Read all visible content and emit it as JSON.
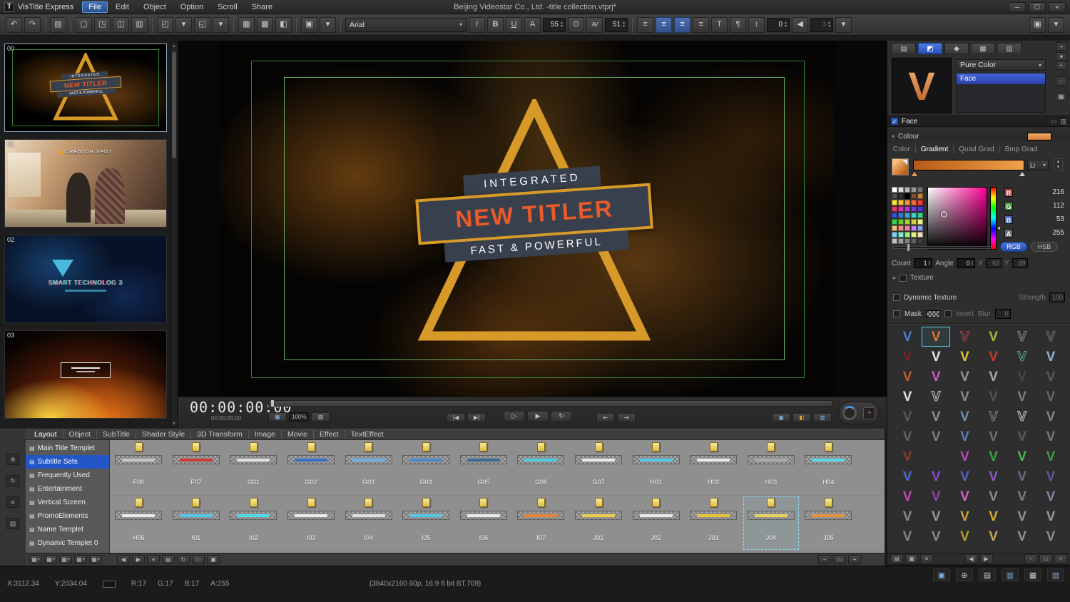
{
  "window": {
    "app_name": "VisTitle Express",
    "title": "Beijing Videostar Co., Ltd. -title collection.vtprj*",
    "menus": [
      "File",
      "Edit",
      "Object",
      "Option",
      "Scroll",
      "Share"
    ],
    "active_menu": "File"
  },
  "icons": {
    "logo": "T",
    "minimize": "─",
    "maximize": "▢",
    "close": "×",
    "undo": "↶",
    "redo": "↷",
    "template-browser": "▤",
    "new-doc": "▢",
    "open-doc": "◳",
    "save-doc": "◫",
    "page-setup": "▥",
    "import": "◰",
    "export": "◱",
    "align-objects": "▦",
    "distribute": "▩",
    "group": "◧",
    "image-tool": "▣",
    "italic": "I",
    "bold": "B",
    "underline": "U",
    "font-size": "A",
    "lock": "⊙",
    "kerning": "AV",
    "align-left": "≡",
    "align-center": "≡",
    "align-right": "≡",
    "align-justify": "≡",
    "vertical-text": "T",
    "text-direction": "¶",
    "line-spacing": "↕",
    "audio": "◀",
    "dropdown": "▾",
    "monitor": "▣",
    "left-arrow": "◀",
    "right-arrow": "▶",
    "list-view": "≡",
    "grid-view": "▤",
    "small-grid": "▦",
    "loop": "↻",
    "rect": "▭",
    "minus": "−",
    "plus": "+",
    "plus-circle": "⊕",
    "levels": "▥",
    "frame-back": "|◀",
    "frame-fwd": "▶|",
    "play-outline": "▷",
    "play": "▶",
    "jump-start": "⇤",
    "jump-end": "⇥",
    "zoom-a": "▦",
    "zoom-b": "▧",
    "screen-1": "▣",
    "screen-2": "◧",
    "screen-3": "▥",
    "crosshair": "+",
    "text-tab": "▤",
    "color-tab": "◩",
    "effect-tab": "◆",
    "texture-tab": "▦",
    "library-tab": "▥",
    "check": "✓",
    "collapse": "▾",
    "expand": "▸",
    "up": "▴",
    "down": "▾",
    "hue-marker": "◂",
    "doc": "▤"
  },
  "toolbar": {
    "font_family": "Arial",
    "font_size": "55",
    "kerning": "51",
    "letter_spacing": "0",
    "audio_level": "3",
    "items": [
      {
        "t": "b",
        "i": "undo",
        "n": "undo"
      },
      {
        "t": "b",
        "i": "redo",
        "n": "redo"
      },
      {
        "t": "s"
      },
      {
        "t": "b",
        "i": "template-browser",
        "n": "template-browser"
      },
      {
        "t": "s"
      },
      {
        "t": "b",
        "i": "new-doc",
        "n": "new-document"
      },
      {
        "t": "b",
        "i": "open-doc",
        "n": "open-document"
      },
      {
        "t": "b",
        "i": "save-doc",
        "n": "save-document"
      },
      {
        "t": "b",
        "i": "page-setup",
        "n": "page-setup"
      },
      {
        "t": "s"
      },
      {
        "t": "b",
        "i": "import",
        "n": "import-template"
      },
      {
        "t": "b",
        "i": "dropdown",
        "n": "import-options"
      },
      {
        "t": "b",
        "i": "export",
        "n": "export-template"
      },
      {
        "t": "b",
        "i": "dropdown",
        "n": "export-options"
      },
      {
        "t": "s"
      },
      {
        "t": "b",
        "i": "align-objects",
        "n": "align-objects"
      },
      {
        "t": "b",
        "i": "distribute",
        "n": "distribute-objects"
      },
      {
        "t": "b",
        "i": "group",
        "n": "group-objects"
      },
      {
        "t": "s"
      },
      {
        "t": "b",
        "i": "image-tool",
        "n": "insert-image"
      },
      {
        "t": "b",
        "i": "dropdown",
        "n": "insert-options"
      },
      {
        "t": "s"
      },
      {
        "t": "font",
        "n": "font-family-select",
        "bind": "font_family"
      },
      {
        "t": "b",
        "i": "italic",
        "n": "italic"
      },
      {
        "t": "b",
        "i": "bold",
        "n": "bold"
      },
      {
        "t": "b",
        "i": "underline",
        "n": "underline"
      },
      {
        "t": "b",
        "i": "font-size",
        "n": "font-size"
      },
      {
        "t": "spin",
        "n": "font-size-value",
        "bind": "font_size"
      },
      {
        "t": "b",
        "i": "lock",
        "n": "lock-aspect"
      },
      {
        "t": "b",
        "i": "kerning",
        "n": "kerning"
      },
      {
        "t": "spin",
        "n": "kerning-value",
        "bind": "kerning"
      },
      {
        "t": "s"
      },
      {
        "t": "b",
        "i": "align-left",
        "n": "align-left"
      },
      {
        "t": "b",
        "i": "align-center",
        "n": "align-center",
        "sel": true
      },
      {
        "t": "b",
        "i": "align-right",
        "n": "align-right",
        "sel": true
      },
      {
        "t": "b",
        "i": "align-justify",
        "n": "align-justify"
      },
      {
        "t": "b",
        "i": "vertical-text",
        "n": "vertical-text"
      },
      {
        "t": "b",
        "i": "text-direction",
        "n": "text-direction"
      },
      {
        "t": "b",
        "i": "line-spacing",
        "n": "line-spacing"
      },
      {
        "t": "spin",
        "n": "letter-spacing-value",
        "bind": "letter_spacing"
      },
      {
        "t": "b",
        "i": "audio",
        "n": "audio-sync"
      },
      {
        "t": "spin",
        "n": "audio-level-value",
        "bind": "audio_level",
        "dis": true
      },
      {
        "t": "b",
        "i": "dropdown",
        "n": "more-text-options"
      },
      {
        "t": "gap"
      },
      {
        "t": "b",
        "i": "monitor",
        "n": "external-monitor"
      },
      {
        "t": "b",
        "i": "dropdown",
        "n": "monitor-options"
      }
    ]
  },
  "thumbnails": {
    "items": [
      {
        "index": "00"
      },
      {
        "index": "01",
        "caption": "CREATOR SPOT"
      },
      {
        "index": "02",
        "caption": "SMART TECHNOLOG 3"
      },
      {
        "index": "03"
      }
    ]
  },
  "preview": {
    "banner": {
      "line1": "INTEGRATED",
      "line2": "NEW TITLER",
      "line3": "FAST & POWERFUL"
    },
    "timecode": "00:00:00:00",
    "timecode_sub": "00:00:05:00",
    "zoom": "100%"
  },
  "panel_tabs": [
    "Layout",
    "Object",
    "SubTitle",
    "Shader Style",
    "3D Transform",
    "Image",
    "Movie",
    "Effect",
    "TextEffect"
  ],
  "categories": {
    "items": [
      {
        "label": "Main Title Templet"
      },
      {
        "label": "Subtitle Sets",
        "selected": true
      },
      {
        "label": "Frequently Used"
      },
      {
        "label": "Entertainment"
      },
      {
        "label": "Vertical Screen"
      },
      {
        "label": "PromoElements"
      },
      {
        "label": "Name Templet"
      },
      {
        "label": "Dynamic Templet 0"
      }
    ]
  },
  "templates": {
    "selected": "J04",
    "rows": [
      [
        {
          "label": "F06",
          "c": "#c9c9c9"
        },
        {
          "label": "F07",
          "c": "#cc3b33"
        },
        {
          "label": "G01",
          "c": "#e2e2e2"
        },
        {
          "label": "G02",
          "c": "#3a6fc9"
        },
        {
          "label": "G03",
          "c": "#6fb3e0"
        },
        {
          "label": "G04",
          "c": "#4a8ad0"
        },
        {
          "label": "G05",
          "c": "#3a6a9a"
        },
        {
          "label": "G06",
          "c": "#4ecfe0"
        },
        {
          "label": "G07",
          "c": "#ececec"
        },
        {
          "label": "H01",
          "c": "#55c9e8"
        },
        {
          "label": "H02",
          "c": "#ececec"
        },
        {
          "label": "H03",
          "c": "#ababab"
        },
        {
          "label": "H04",
          "c": "#5fd8e8"
        }
      ],
      [
        {
          "label": "H05",
          "c": "#ececec"
        },
        {
          "label": "I01",
          "c": "#55c9e8"
        },
        {
          "label": "I02",
          "c": "#4adce8"
        },
        {
          "label": "I03",
          "c": "#ececec"
        },
        {
          "label": "I04",
          "c": "#e0e0e0"
        },
        {
          "label": "I05",
          "c": "#55c9e8"
        },
        {
          "label": "I06",
          "c": "#ececec"
        },
        {
          "label": "I07",
          "c": "#e8833a"
        },
        {
          "label": "J01",
          "c": "#e8cc4a"
        },
        {
          "label": "J02",
          "c": "#ececec"
        },
        {
          "label": "J03",
          "c": "#e8c533"
        },
        {
          "label": "J04",
          "c": "#e8d45f"
        },
        {
          "label": "J05",
          "c": "#e8943a"
        }
      ]
    ]
  },
  "rp": {
    "tabs": [
      {
        "n": "text-settings",
        "i": "text-tab"
      },
      {
        "n": "color-settings",
        "i": "color-tab",
        "sel": true
      },
      {
        "n": "effect-settings",
        "i": "effect-tab"
      },
      {
        "n": "texture-settings",
        "i": "texture-tab"
      },
      {
        "n": "style-library",
        "i": "library-tab"
      }
    ],
    "preview_letter": "V",
    "shader_mode": "Pure Color",
    "layers": [
      {
        "label": "Face",
        "selected": true
      }
    ],
    "face_section": "Face",
    "colour_label": "Colour",
    "gradient_tabs": [
      "Color",
      "Gradient",
      "Quad Grad",
      "Bmp Grad"
    ],
    "gradient_selected": "Gradient",
    "li_label": "Li",
    "gradient_colors": [
      "#b55a16",
      "#f2a24a"
    ],
    "palette": [
      "#ffffff",
      "#dbdbdb",
      "#b8b8b8",
      "#969696",
      "#737373",
      "#515151",
      "#2e2e2e",
      "#000000",
      "#7a5230",
      "#c0843c",
      "#f5e93a",
      "#f5c53a",
      "#f59a3a",
      "#f56a3a",
      "#f53a3a",
      "#e03a70",
      "#d03aa8",
      "#b03ad0",
      "#7a3ad0",
      "#4a3ad0",
      "#3a50d0",
      "#3a7ad0",
      "#3aa8d0",
      "#3ad0c8",
      "#3ad08a",
      "#3ad050",
      "#6ad03a",
      "#a8d03a",
      "#d0d03a",
      "#f0f080",
      "#f0c080",
      "#f09080",
      "#f080b0",
      "#c080f0",
      "#80a0f0",
      "#80d0f0",
      "#80f0d0",
      "#a0f080",
      "#e0f080",
      "#f0e0c0",
      "#c0c0c0",
      "#a0a0a0",
      "#808080",
      "#606060",
      "#404040"
    ],
    "rgba": [
      {
        "ch": "R",
        "v": "216",
        "c": "#b04545"
      },
      {
        "ch": "G",
        "v": "112",
        "c": "#3f9a3f"
      },
      {
        "ch": "B",
        "v": "53",
        "c": "#4564c0"
      },
      {
        "ch": "A",
        "v": "255",
        "c": "#6f6f78"
      }
    ],
    "rgb_btn": "RGB",
    "hsb_btn": "HSB",
    "count_label": "Count",
    "count": "1",
    "angle_label": "Angle",
    "angle": "0",
    "x_label": "X",
    "x": "62",
    "y_label": "Y",
    "y": "89",
    "texture_label": "Texture",
    "dynamic_texture_label": "Dynamic Texture",
    "strength_label": "Strength",
    "strength": "100",
    "mask_label": "Mask",
    "invert_label": "Invert",
    "blur_label": "Blur",
    "blur": "0",
    "style_grid": {
      "letter": "V",
      "selected_index": 1,
      "items": [
        [
          "#4d7fd0",
          null
        ],
        [
          "#e0762e",
          null
        ],
        [
          "#2b2b2b",
          "#a84848"
        ],
        [
          "#a9b93a",
          null
        ],
        [
          "#323232",
          "#8a8a8a"
        ],
        [
          "#3a3a3a",
          "#6a6a6a"
        ],
        [
          "#7a2424",
          null
        ],
        [
          "#e6e6e6",
          null
        ],
        [
          "#e3c231",
          null
        ],
        [
          "#c23a32",
          null
        ],
        [
          "#252525",
          "#59b08a"
        ],
        [
          "#8fb3d9",
          null
        ],
        [
          "#c05a28",
          null
        ],
        [
          "#cc59c4",
          null
        ],
        [
          "#969696",
          null
        ],
        [
          "#ababab",
          null
        ],
        [
          "#454545",
          null
        ],
        [
          "#5a5a5a",
          null
        ],
        [
          "#e0e0e0",
          null
        ],
        [
          "#2e2e2e",
          "#c8c8c8"
        ],
        [
          "#8a8a8a",
          null
        ],
        [
          "#51515a",
          null
        ],
        [
          "#7a7a82",
          null
        ],
        [
          "#68686f",
          null
        ],
        [
          "#565656",
          null
        ],
        [
          "#8f8f8f",
          null
        ],
        [
          "#6b8fb3",
          null
        ],
        [
          "#3a3a3a",
          "#7a7a7a"
        ],
        [
          "#2e2e2e",
          "#cfcfcf"
        ],
        [
          "#848484",
          null
        ],
        [
          "#646464",
          null
        ],
        [
          "#7e7e7e",
          null
        ],
        [
          "#5b7cc0",
          null
        ],
        [
          "#6f6f6f",
          null
        ],
        [
          "#5a5a5a",
          null
        ],
        [
          "#787878",
          null
        ],
        [
          "#8c3a20",
          null
        ],
        [
          "#2a2a2a",
          null
        ],
        [
          "#b34ab3",
          null
        ],
        [
          "#3aa34a",
          null
        ],
        [
          "#4ab85a",
          null
        ],
        [
          "#3f9a44",
          null
        ],
        [
          "#4a69c9",
          null
        ],
        [
          "#8a4ac9",
          null
        ],
        [
          "#5263c3",
          null
        ],
        [
          "#9059c9",
          null
        ],
        [
          "#6a6a85",
          null
        ],
        [
          "#5a5aa0",
          null
        ],
        [
          "#c34ab3",
          null
        ],
        [
          "#9343ab",
          null
        ],
        [
          "#d263c3",
          null
        ],
        [
          "#8a8a99",
          null
        ],
        [
          "#7a7a8a",
          null
        ],
        [
          "#8585a0",
          null
        ],
        [
          "#8a8a8a",
          null
        ],
        [
          "#9a9a9a",
          null
        ],
        [
          "#c9a332",
          null
        ],
        [
          "#d4ad3a",
          null
        ],
        [
          "#939393",
          null
        ],
        [
          "#9c9c9c",
          null
        ],
        [
          "#838383",
          null
        ],
        [
          "#8b8b8b",
          null
        ],
        [
          "#b99a2a",
          null
        ],
        [
          "#c2a95a",
          null
        ],
        [
          "#909090",
          null
        ],
        [
          "#8d8d8d",
          null
        ]
      ]
    }
  },
  "left_rail": [
    {
      "n": "pin-panel",
      "i": "plus-circle"
    },
    {
      "n": "link-scroll",
      "i": "loop"
    },
    {
      "n": "list-mode",
      "i": "list-view"
    },
    {
      "n": "grid-mode",
      "i": "grid-view"
    }
  ],
  "bottom_bar": {
    "left": [
      {
        "n": "preset-filter-1",
        "i": "small-grid"
      },
      {
        "n": "preset-filter-2",
        "i": "small-grid"
      },
      {
        "n": "preset-filter-3",
        "i": "small-grid"
      },
      {
        "n": "preset-filter-4",
        "i": "small-grid"
      },
      {
        "n": "preset-filter-5",
        "i": "small-grid"
      }
    ],
    "mid": [
      {
        "n": "nav-back",
        "i": "left-arrow"
      },
      {
        "n": "nav-forward",
        "i": "right-arrow"
      },
      {
        "n": "view-list",
        "i": "list-view"
      },
      {
        "n": "view-thumbnails",
        "i": "grid-view"
      },
      {
        "n": "refresh-templates",
        "i": "loop"
      },
      {
        "n": "slideshow",
        "i": "rect"
      },
      {
        "n": "template-info",
        "i": "monitor"
      }
    ],
    "right": [
      {
        "n": "zoom-out",
        "i": "minus"
      },
      {
        "n": "zoom-fit",
        "i": "rect"
      },
      {
        "n": "zoom-in",
        "i": "plus"
      }
    ]
  },
  "rp_foot": {
    "left": [
      {
        "n": "preset-view-large",
        "i": "grid-view"
      },
      {
        "n": "preset-view-medium",
        "i": "small-grid"
      },
      {
        "n": "preset-view-list",
        "i": "list-view"
      }
    ],
    "mid": [
      {
        "n": "preset-page-prev",
        "i": "left-arrow"
      },
      {
        "n": "preset-page-next",
        "i": "right-arrow"
      }
    ],
    "right": [
      {
        "n": "preset-zoom-out",
        "i": "minus"
      },
      {
        "n": "preset-zoom-fit",
        "i": "rect"
      },
      {
        "n": "preset-zoom-in",
        "i": "plus"
      }
    ]
  },
  "status": {
    "x": "X:3112.34",
    "y": "Y:2034.04",
    "r": "R:17",
    "g": "G:17",
    "b": "B:17",
    "a": "A:255",
    "format": "(3840x2160 60p, 16:9 8 bit BT.709)",
    "icons": [
      {
        "n": "preview-monitor",
        "i": "monitor",
        "c": "#7ab0e0"
      },
      {
        "n": "settings-tools",
        "i": "plus-circle",
        "c": "#c9c9c9"
      },
      {
        "n": "media-library",
        "i": "grid-view",
        "c": "#c9c9c9"
      },
      {
        "n": "audio-levels",
        "i": "levels",
        "c": "#7ab0e0"
      },
      {
        "n": "device-output",
        "i": "small-grid",
        "c": "#c9c9c9"
      },
      {
        "n": "program-monitor",
        "i": "library-tab",
        "c": "#7ab0e0"
      }
    ]
  }
}
